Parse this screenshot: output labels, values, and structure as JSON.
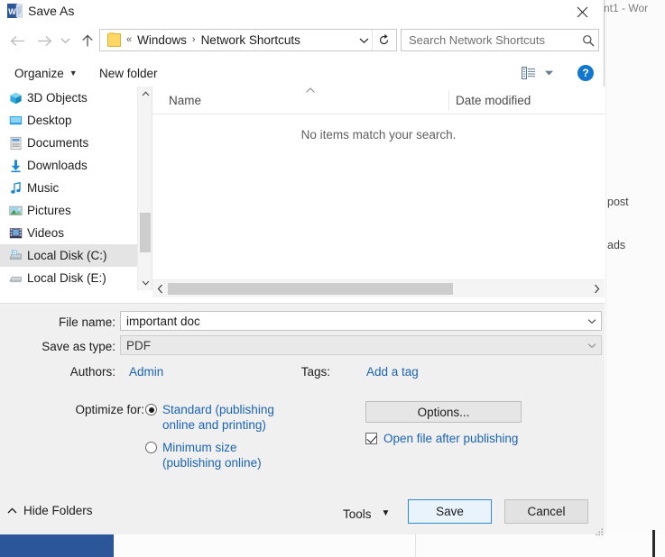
{
  "background": {
    "window_title": "nt1 - Wor",
    "items": [
      "post",
      "ads"
    ]
  },
  "dialog": {
    "title": "Save As",
    "app_icon": "word-icon",
    "close_icon": "close-icon",
    "nav": {
      "back_icon": "back-arrow-icon",
      "forward_icon": "forward-arrow-icon",
      "recent_icon": "chevron-down-icon",
      "up_icon": "up-arrow-icon"
    },
    "address": {
      "folder_icon": "folder-icon",
      "overflow": "«",
      "separator": "›",
      "segments": [
        "Windows",
        "Network Shortcuts"
      ],
      "dropdown_icon": "chevron-down-icon",
      "refresh_icon": "refresh-icon"
    },
    "search": {
      "placeholder": "Search Network Shortcuts",
      "value": "",
      "icon": "search-icon"
    },
    "commandbar": {
      "organize": "Organize",
      "new_folder": "New folder",
      "view_icon": "list-view-icon",
      "view_caret_icon": "chevron-down-icon",
      "help_label": "?"
    },
    "tree": {
      "items": [
        {
          "label": "3D Objects",
          "icon": "3d-objects-icon",
          "selected": false
        },
        {
          "label": "Desktop",
          "icon": "desktop-icon",
          "selected": false
        },
        {
          "label": "Documents",
          "icon": "documents-icon",
          "selected": false
        },
        {
          "label": "Downloads",
          "icon": "downloads-icon",
          "selected": false
        },
        {
          "label": "Music",
          "icon": "music-icon",
          "selected": false
        },
        {
          "label": "Pictures",
          "icon": "pictures-icon",
          "selected": false
        },
        {
          "label": "Videos",
          "icon": "videos-icon",
          "selected": false
        },
        {
          "label": "Local Disk (C:)",
          "icon": "drive-icon",
          "selected": true
        },
        {
          "label": "Local Disk (E:)",
          "icon": "drive-icon",
          "selected": false
        }
      ],
      "scroll_up_icon": "chevron-up-icon",
      "scroll_down_icon": "chevron-down-icon"
    },
    "filelist": {
      "columns": [
        "Name",
        "Date modified"
      ],
      "sort_icon": "sort-ascending-icon",
      "empty_message": "No items match your search.",
      "rows": []
    },
    "hscroll": {
      "left_icon": "chevron-left-icon",
      "right_icon": "chevron-right-icon"
    },
    "form": {
      "file_name_label": "File name:",
      "file_name_value": "important doc",
      "save_as_type_label": "Save as type:",
      "save_as_type_value": "PDF",
      "authors_label": "Authors:",
      "authors_value": "Admin",
      "tags_label": "Tags:",
      "tags_value": "Add a tag",
      "optimize_label": "Optimize for:",
      "optimize_options": [
        {
          "line1": "Standard (publishing",
          "line2": "online and printing)",
          "selected": true
        },
        {
          "line1": "Minimum size",
          "line2": "(publishing online)",
          "selected": false
        }
      ],
      "options_button": "Options...",
      "open_after_publishing_label": "Open file after publishing",
      "open_after_publishing_checked": true,
      "dropdown_icon": "chevron-down-icon"
    },
    "footer": {
      "hide_folders": "Hide Folders",
      "hide_folders_icon": "chevron-up-icon",
      "tools": "Tools",
      "tools_caret_icon": "chevron-down-icon",
      "save": "Save",
      "cancel": "Cancel",
      "resize_grip_icon": "resize-grip-icon"
    }
  },
  "colors": {
    "accent_link": "#1a64b4",
    "help_blue": "#1177d1",
    "save_border": "#2f8ad4",
    "word_blue": "#2b579a",
    "panel_bg": "#f0f0f0",
    "selection_bg": "#e4e4e4"
  }
}
